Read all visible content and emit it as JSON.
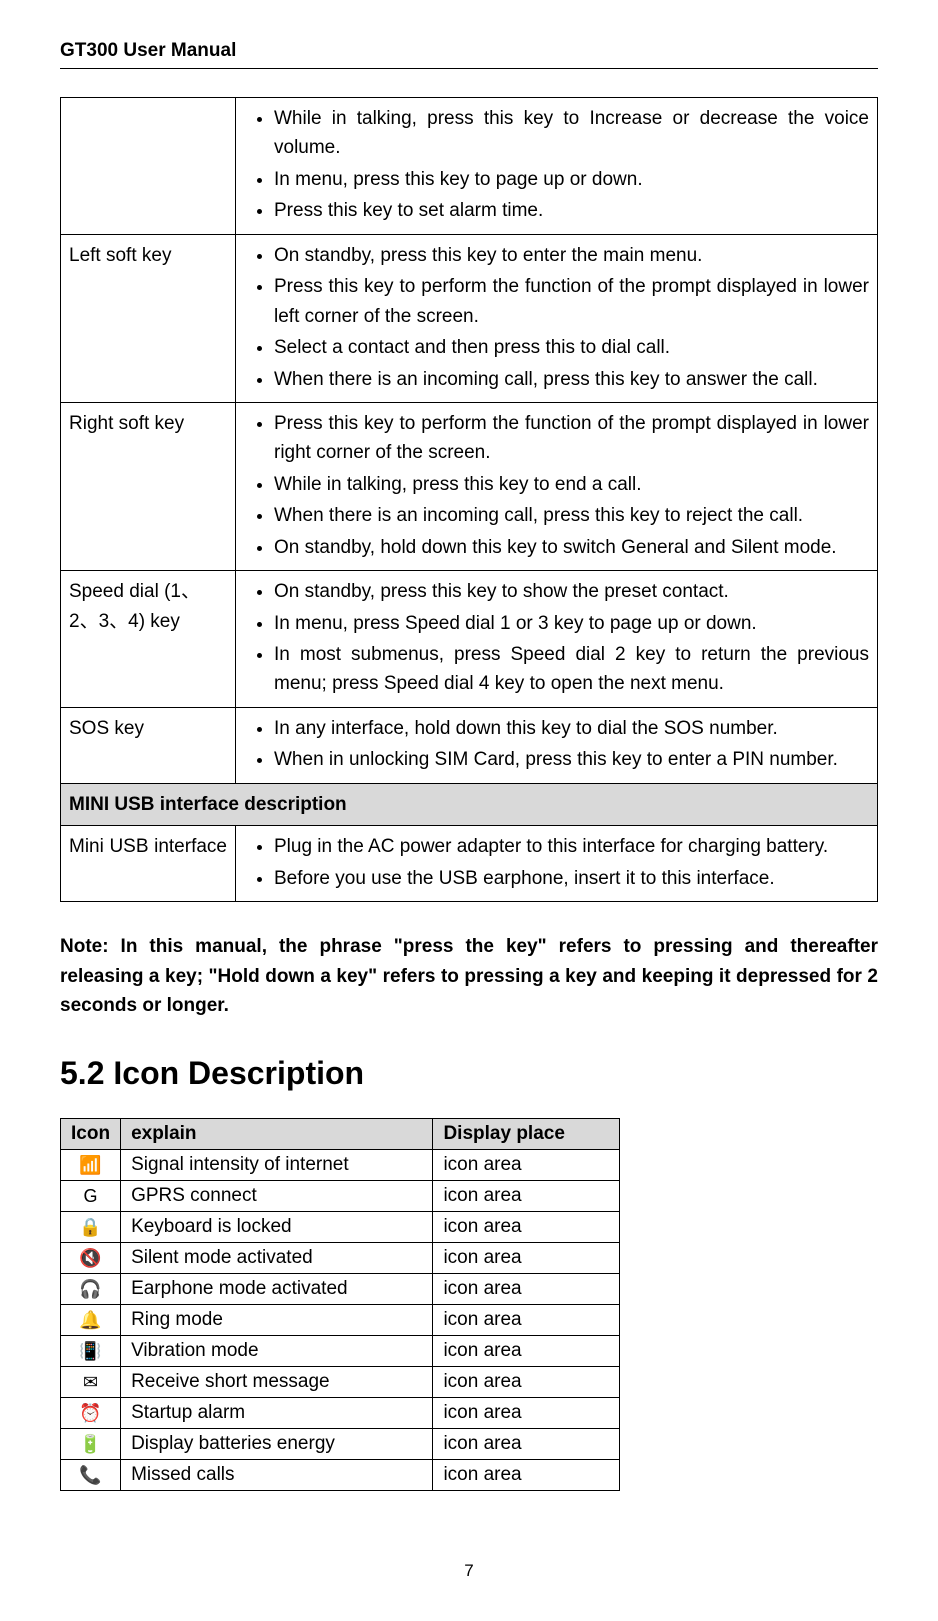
{
  "header": {
    "title": "GT300 User Manual"
  },
  "keys_table": {
    "rows": [
      {
        "key": "",
        "items": [
          "While in talking, press this key to Increase or decrease the voice volume.",
          "In menu, press this key to page up or down.",
          "Press this key to set alarm time."
        ]
      },
      {
        "key": "Left soft key",
        "items": [
          "On standby, press this key to enter the main menu.",
          "Press this key to perform the function of the prompt displayed in lower left corner of the screen.",
          "Select a contact and then press this to dial call.",
          "When there is an incoming call, press this key to answer the call."
        ]
      },
      {
        "key": "Right soft key",
        "items": [
          "Press this key to perform the function of the prompt displayed in lower right corner of the screen.",
          "While in talking, press this key to end a call.",
          "When there is an incoming call, press this key to reject the call.",
          "On standby, hold down this key to switch General and Silent mode."
        ]
      },
      {
        "key": "Speed dial (1、2、3、4) key",
        "items": [
          "On standby, press this key to show the preset contact.",
          "In menu, press Speed dial 1 or 3 key to page up or down.",
          "In most submenus, press Speed dial 2 key to return the previous menu; press Speed dial 4 key to open the next menu."
        ]
      },
      {
        "key": "SOS key",
        "items": [
          "In any interface, hold down this key to dial the SOS number.",
          "When in unlocking SIM Card, press this key to enter a PIN number."
        ]
      }
    ],
    "usb_section_header": "MINI USB interface description",
    "usb_row": {
      "key": "Mini USB interface",
      "items": [
        "Plug in the AC power adapter to this interface for charging battery.",
        "Before you use the USB earphone, insert it to this interface."
      ]
    }
  },
  "note": "Note: In this manual, the phrase \"press the key\" refers to pressing and thereafter releasing a key; \"Hold down a key\" refers to pressing a key and keeping it depressed for 2 seconds or longer.",
  "section_5_2": {
    "heading": "5.2 Icon Description",
    "table": {
      "headers": {
        "icon": "Icon",
        "explain": "explain",
        "place": "Display place"
      },
      "rows": [
        {
          "icon": "signal-icon",
          "glyph": "📶",
          "explain": "Signal intensity of internet",
          "place": "icon area"
        },
        {
          "icon": "gprs-icon",
          "glyph": "G",
          "explain": "GPRS connect",
          "place": "icon area"
        },
        {
          "icon": "lock-icon",
          "glyph": "🔒",
          "explain": "Keyboard is locked",
          "place": "icon area"
        },
        {
          "icon": "silent-icon",
          "glyph": "🔇",
          "explain": "Silent mode activated",
          "place": "icon area"
        },
        {
          "icon": "earphone-icon",
          "glyph": "🎧",
          "explain": "Earphone mode activated",
          "place": "icon area"
        },
        {
          "icon": "ring-icon",
          "glyph": "🔔",
          "explain": "Ring mode",
          "place": "icon area"
        },
        {
          "icon": "vibration-icon",
          "glyph": "📳",
          "explain": "Vibration mode",
          "place": "icon area"
        },
        {
          "icon": "sms-icon",
          "glyph": "✉",
          "explain": "Receive short message",
          "place": "icon area"
        },
        {
          "icon": "alarm-icon",
          "glyph": "⏰",
          "explain": "Startup alarm",
          "place": "icon area"
        },
        {
          "icon": "battery-icon",
          "glyph": "🔋",
          "explain": "Display batteries energy",
          "place": "icon area"
        },
        {
          "icon": "missed-call-icon",
          "glyph": "📞",
          "explain": "Missed calls",
          "place": "icon area"
        }
      ]
    }
  },
  "page_number": "7"
}
